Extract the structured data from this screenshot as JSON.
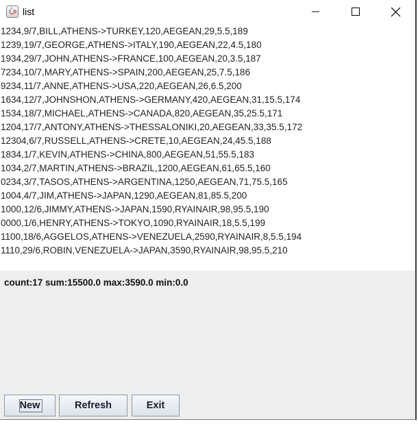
{
  "window": {
    "title": "list"
  },
  "records": [
    "1234,9/7,BILL,ATHENS->TURKEY,120,AEGEAN,29,5.5,189",
    "1239,19/7,GEORGE,ATHENS->ITALY,190,AEGEAN,22,4.5,180",
    "1934,29/7,JOHN,ATHENS->FRANCE,100,AEGEAN,20,3.5,187",
    "7234,10/7,MARY,ATHENS->SPAIN,200,AEGEAN,25,7.5,186",
    "9234,11/7,ANNE,ATHENS->USA,220,AEGEAN,26,6.5,200",
    "1634,12/7,JOHNSHON,ATHENS->GERMANY,420,AEGEAN,31,15.5,174",
    "1534,18/7,MICHAEL,ATHENS->CANADA,820,AEGEAN,35,25.5,171",
    "1204,17/7,ANTONY,ATHENS->THESSALONIKI,20,AEGEAN,33,35.5,172",
    "12304,6/7,RUSSELL,ATHENS->CRETE,10,AEGEAN,24,45.5,188",
    "1834,1/7,KEVIN,ATHENS->CHINA,800,AEGEAN,51,55.5,183",
    "1034,2/7,MARTIN,ATHENS->BRAZIL,1200,AEGEAN,61,65.5,160",
    "0234,3/7,TASOS,ATHENS->ARGENTINA,1250,AEGEAN,71,75.5,165",
    "1004,4/7,JIM,ATHENS->JAPAN,1290,AEGEAN,81,85.5,200",
    "1000,12/6,JIMMY,ATHENS->JAPAN,1590,RYAINAIR,98,95.5,190",
    "0000,1/6,HENRY,ATHENS->TOKYO,1090,RYAINAIR,18,5.5,199",
    "1100,18/6,AGGELOS,ATHENS->VENEZUELA,2590,RYAINAIR,8,5.5,194",
    "1110,29/6,ROBIN,VENEZUELA->JAPAN,3590,RYAINAIR,98,95.5,210"
  ],
  "stats": "count:17  sum:15500.0  max:3590.0  min:0.0",
  "buttons": {
    "new": "New",
    "refresh": "Refresh",
    "exit": "Exit"
  }
}
